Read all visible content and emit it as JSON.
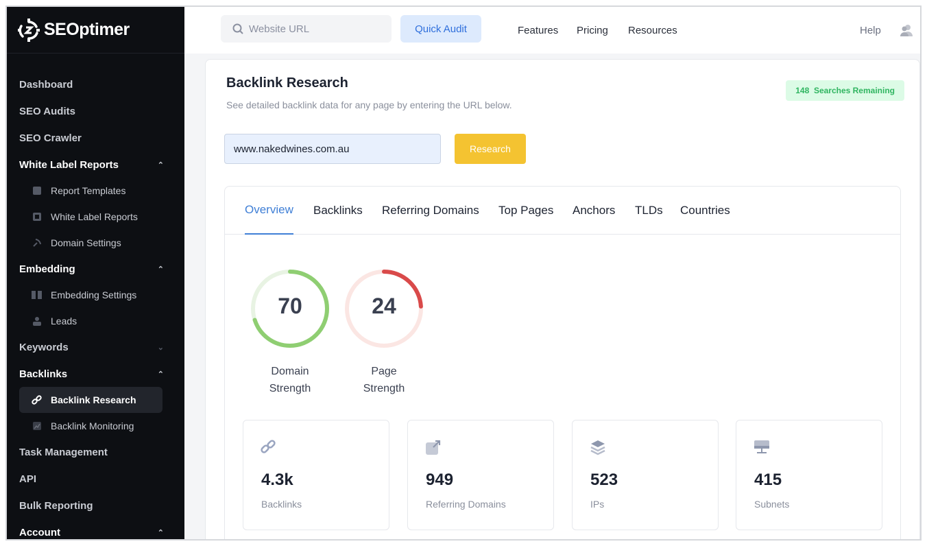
{
  "brand": {
    "name": "SEOptimer"
  },
  "sidebar": {
    "items": [
      {
        "label": "Dashboard"
      },
      {
        "label": "SEO Audits"
      },
      {
        "label": "SEO Crawler"
      },
      {
        "label": "White Label Reports",
        "expanded": true
      },
      {
        "label": "Report Templates",
        "icon": "template-icon"
      },
      {
        "label": "White Label Reports",
        "icon": "report-icon"
      },
      {
        "label": "Domain Settings",
        "icon": "satellite-icon"
      },
      {
        "label": "Embedding",
        "expanded": true
      },
      {
        "label": "Embedding Settings",
        "icon": "embed-icon"
      },
      {
        "label": "Leads",
        "icon": "leads-icon"
      },
      {
        "label": "Keywords",
        "expanded": false
      },
      {
        "label": "Backlinks",
        "expanded": true
      },
      {
        "label": "Backlink Research",
        "icon": "link-icon",
        "active": true
      },
      {
        "label": "Backlink Monitoring",
        "icon": "chart-icon"
      },
      {
        "label": "Task Management"
      },
      {
        "label": "API"
      },
      {
        "label": "Bulk Reporting"
      },
      {
        "label": "Account",
        "expanded": true
      }
    ]
  },
  "topbar": {
    "search_placeholder": "Website URL",
    "quick_audit": "Quick Audit",
    "features": "Features",
    "pricing": "Pricing",
    "resources": "Resources",
    "help": "Help"
  },
  "main": {
    "title": "Backlink Research",
    "subtitle": "See detailed backlink data for any page by entering the URL below.",
    "searches_count": "148",
    "searches_label": "Searches Remaining",
    "url_value": "www.nakedwines.com.au",
    "research_button": "Research",
    "tabs": [
      "Overview",
      "Backlinks",
      "Referring Domains",
      "Top Pages",
      "Anchors",
      "TLDs",
      "Countries"
    ],
    "gauges": [
      {
        "value": "70",
        "fraction": 0.7,
        "label1": "Domain",
        "label2": "Strength",
        "color": "#8fce72",
        "track": "#e8f3e3"
      },
      {
        "value": "24",
        "fraction": 0.24,
        "label1": "Page",
        "label2": "Strength",
        "color": "#d94a4a",
        "track": "#fbe6e3"
      }
    ],
    "stats": [
      {
        "value": "4.3k",
        "label": "Backlinks",
        "icon": "link-icon"
      },
      {
        "value": "949",
        "label": "Referring Domains",
        "icon": "external-link-icon"
      },
      {
        "value": "523",
        "label": "IPs",
        "icon": "layers-icon"
      },
      {
        "value": "415",
        "label": "Subnets",
        "icon": "network-icon"
      }
    ]
  },
  "colors": {
    "accent": "#3f7fd6",
    "research": "#f4c331",
    "sidebar": "#0d0f13"
  }
}
